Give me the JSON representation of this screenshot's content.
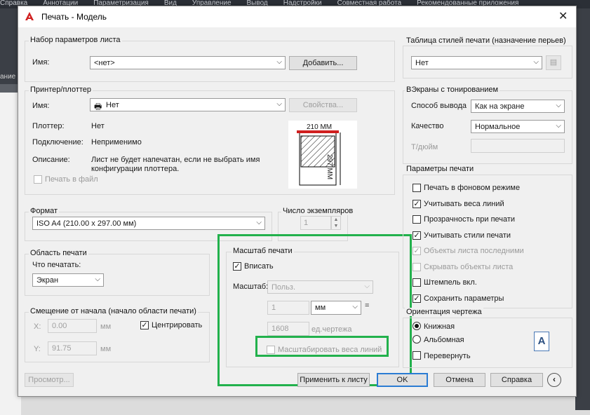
{
  "ribbon": [
    "Справка",
    "Аннотации",
    "Параметризация",
    "Вид",
    "Управление",
    "Вывод",
    "Надстройки",
    "Совместная работа",
    "Рекомендованные приложения"
  ],
  "app_side_label": "ание",
  "dialog": {
    "title": "Печать - Модель"
  },
  "page_setup": {
    "group": "Набор параметров листа",
    "name_label": "Имя:",
    "name_value": "<нет>",
    "add_button": "Добавить..."
  },
  "printer": {
    "group": "Принтер/плоттер",
    "name_label": "Имя:",
    "name_value": "Нет",
    "properties_button": "Свойства...",
    "plotter_label": "Плоттер:",
    "plotter_value": "Нет",
    "connection_label": "Подключение:",
    "connection_value": "Неприменимо",
    "description_label": "Описание:",
    "description_value": "Лист не будет напечатан, если не выбрать имя конфигурации плоттера.",
    "print_to_file": "Печать в файл",
    "preview_width": "210 MM",
    "preview_height": "297 MM"
  },
  "paper": {
    "group": "Формат",
    "value": "ISO A4 (210.00 x 297.00 мм)"
  },
  "copies": {
    "label": "Число экземпляров",
    "value": "1"
  },
  "area": {
    "group": "Область печати",
    "what_label": "Что печатать:",
    "what_value": "Экран"
  },
  "offset": {
    "group": "Смещение от начала (начало области печати)",
    "x_label": "X:",
    "x_value": "0.00",
    "y_label": "Y:",
    "y_value": "91.75",
    "unit": "мм",
    "center": "Центрировать"
  },
  "scale": {
    "group": "Масштаб печати",
    "fit": "Вписать",
    "scale_label": "Масштаб:",
    "scale_value": "Польз.",
    "num_value": "1",
    "unit_value": "мм",
    "eq": "=",
    "den_value": "1608",
    "den_unit": "ед.чертежа",
    "lineweights": "Масштабировать веса линий"
  },
  "style_table": {
    "group": "Таблица стилей печати (назначение перьев)",
    "value": "Нет"
  },
  "shaded": {
    "group": "ВЭкраны с тонированием",
    "output_label": "Способ вывода",
    "output_value": "Как на экране",
    "quality_label": "Качество",
    "quality_value": "Нормальное",
    "dpi_label": "Т/дюйм"
  },
  "options": {
    "group": "Параметры печати",
    "items": [
      {
        "label": "Печать в фоновом режиме",
        "checked": false,
        "disabled": false
      },
      {
        "label": "Учитывать веса линий",
        "checked": true,
        "disabled": false
      },
      {
        "label": "Прозрачность при печати",
        "checked": false,
        "disabled": false
      },
      {
        "label": "Учитывать стили печати",
        "checked": true,
        "disabled": false
      },
      {
        "label": "Объекты листа последними",
        "checked": true,
        "disabled": true
      },
      {
        "label": "Скрывать объекты листа",
        "checked": false,
        "disabled": true
      },
      {
        "label": "Штемпель вкл.",
        "checked": false,
        "disabled": false
      },
      {
        "label": "Сохранить параметры",
        "checked": true,
        "disabled": false
      }
    ]
  },
  "orientation": {
    "group": "Ориентация чертежа",
    "portrait": "Книжная",
    "landscape": "Альбомная",
    "reverse": "Перевернуть",
    "icon_letter": "A"
  },
  "buttons": {
    "preview": "Просмотр...",
    "apply": "Применить к листу",
    "ok": "OK",
    "cancel": "Отмена",
    "help": "Справка"
  },
  "colors": {
    "highlight": "#22b14c",
    "brand_red": "#d01f1f",
    "ok_border": "#2b7cd3"
  }
}
